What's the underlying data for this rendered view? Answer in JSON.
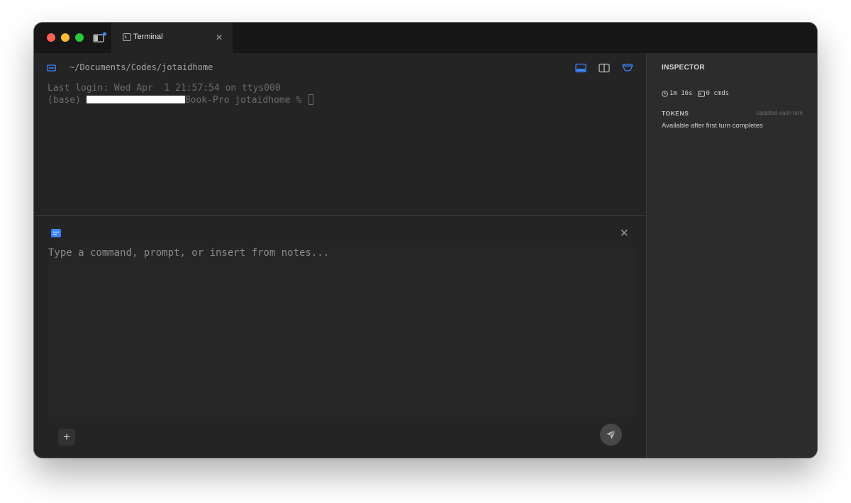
{
  "colors": {
    "accent": "#3b82f6"
  },
  "tab": {
    "label": "Terminal",
    "icon": "terminal-icon"
  },
  "terminal": {
    "path": "~/Documents/Codes/jotaidhome",
    "login_line": "Last login: Wed Apr  1 21:57:54 on ttys000",
    "prompt_prefix": "(base) ",
    "prompt_suffix": "Book-Pro jotaidhome % "
  },
  "composer": {
    "placeholder": "Type a command, prompt, or insert from notes..."
  },
  "inspector": {
    "title": "INSPECTOR",
    "duration": "1m 16s",
    "commands": "0 cmds",
    "tokens_label": "TOKENS",
    "tokens_hint": "Updated each turn",
    "tokens_status": "Available after first turn completes"
  }
}
